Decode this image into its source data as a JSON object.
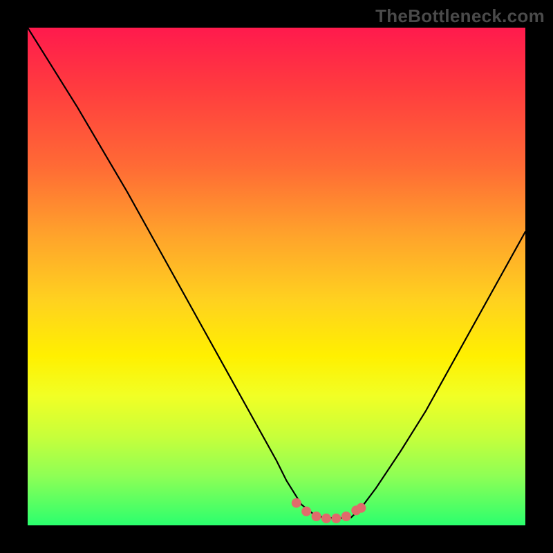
{
  "watermark": "TheBottleneck.com",
  "chart_data": {
    "type": "line",
    "title": "",
    "xlabel": "",
    "ylabel": "",
    "xlim": [
      0,
      100
    ],
    "ylim": [
      0,
      100
    ],
    "grid": false,
    "series": [
      {
        "name": "bottleneck-curve",
        "x": [
          0,
          5,
          10,
          15,
          20,
          25,
          30,
          35,
          40,
          45,
          50,
          52,
          55,
          58,
          62,
          65,
          67,
          70,
          75,
          80,
          85,
          90,
          95,
          100
        ],
        "y": [
          100,
          92,
          84,
          75.5,
          67,
          58,
          49,
          40,
          31,
          22,
          13,
          9,
          4.2,
          1.8,
          1.4,
          1.6,
          3.5,
          7.5,
          15,
          23,
          32,
          41,
          50,
          59
        ]
      }
    ],
    "markers": {
      "name": "optimal-range",
      "color": "#e06b6b",
      "x": [
        54,
        56,
        58,
        60,
        62,
        64,
        66,
        67
      ],
      "y": [
        4.5,
        2.8,
        1.8,
        1.4,
        1.4,
        1.8,
        3.0,
        3.5
      ]
    },
    "gradient_stops": [
      {
        "pos": 0,
        "color": "#ff1a4d"
      },
      {
        "pos": 12,
        "color": "#ff3b3f"
      },
      {
        "pos": 28,
        "color": "#ff6b35"
      },
      {
        "pos": 42,
        "color": "#ffa42b"
      },
      {
        "pos": 55,
        "color": "#ffd21f"
      },
      {
        "pos": 66,
        "color": "#fff000"
      },
      {
        "pos": 74,
        "color": "#f1ff25"
      },
      {
        "pos": 82,
        "color": "#c8ff3a"
      },
      {
        "pos": 90,
        "color": "#8fff55"
      },
      {
        "pos": 100,
        "color": "#2bff6e"
      }
    ]
  }
}
